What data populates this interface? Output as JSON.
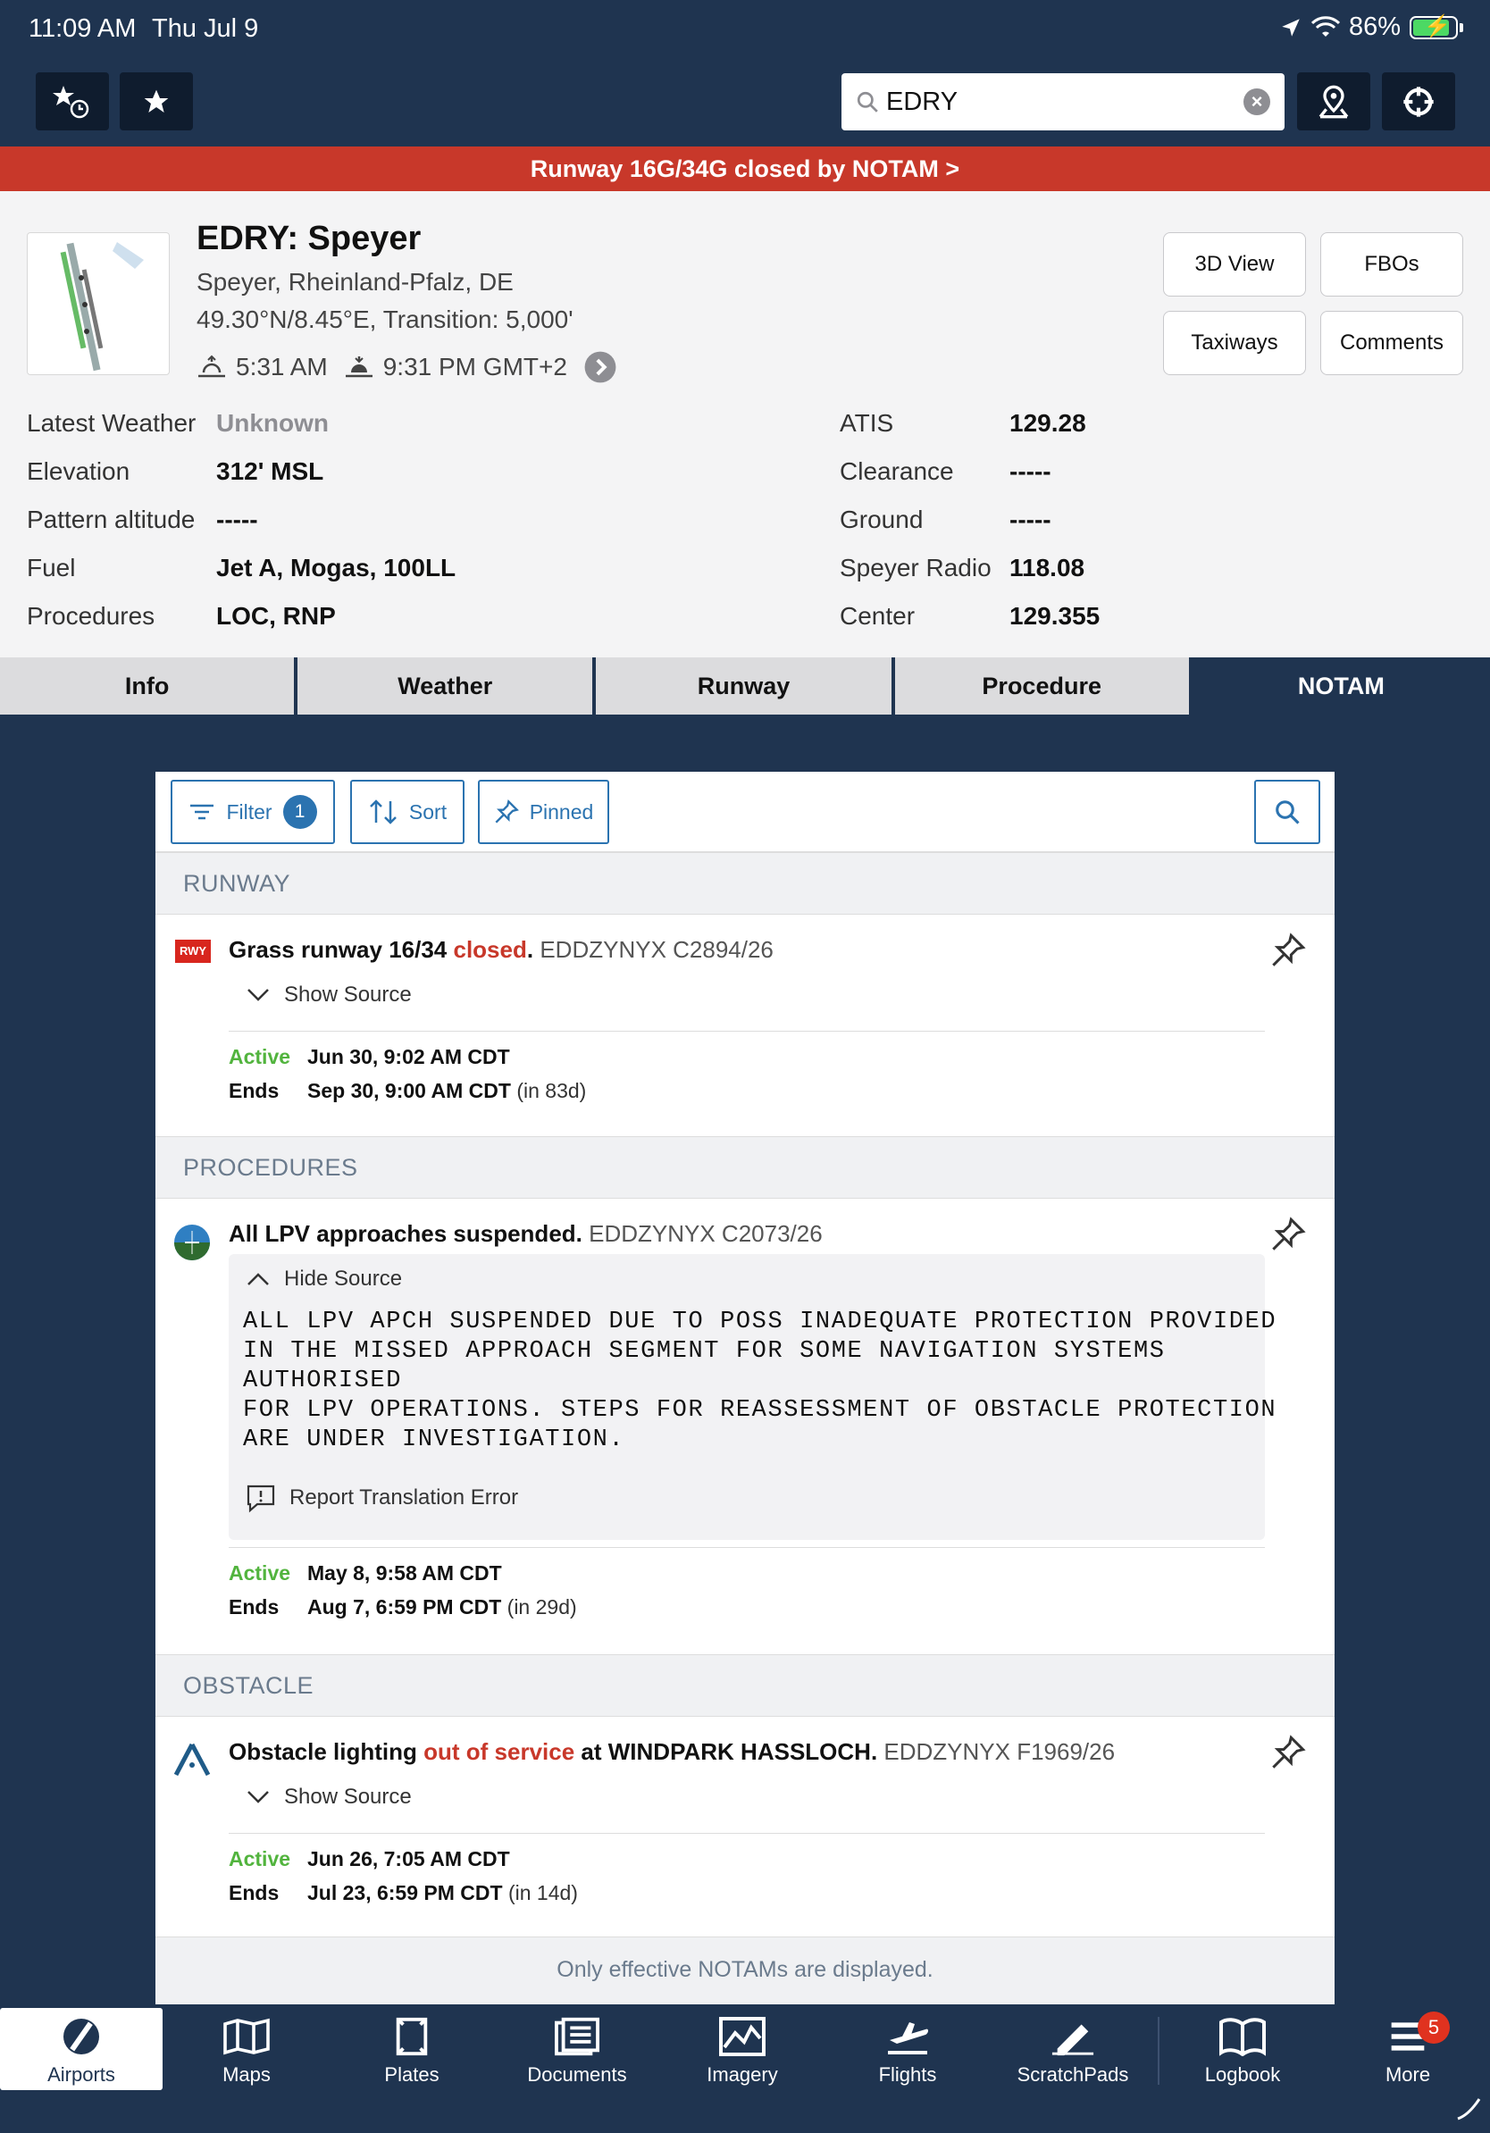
{
  "status_bar": {
    "time": "11:09 AM",
    "date": "Thu Jul 9",
    "battery": "86%"
  },
  "search": {
    "value": "EDRY"
  },
  "alert": {
    "text": "Runway 16G/34G closed by NOTAM >"
  },
  "airport": {
    "title": "EDRY: Speyer",
    "location": "Speyer, Rheinland-Pfalz, DE",
    "coords": "49.30°N/8.45°E, Transition: 5,000'",
    "sunrise": "5:31 AM",
    "sunset": "9:31 PM GMT+2"
  },
  "header_buttons": {
    "view3d": "3D View",
    "fbos": "FBOs",
    "taxiways": "Taxiways",
    "comments": "Comments"
  },
  "info_left": [
    {
      "label": "Latest Weather",
      "value": "Unknown"
    },
    {
      "label": "Elevation",
      "value": "312' MSL"
    },
    {
      "label": "Pattern altitude",
      "value": "-----"
    },
    {
      "label": "Fuel",
      "value": "Jet A, Mogas, 100LL"
    },
    {
      "label": "Procedures",
      "value": "LOC, RNP"
    }
  ],
  "info_right": [
    {
      "label": "ATIS",
      "value": "129.28"
    },
    {
      "label": "Clearance",
      "value": "-----"
    },
    {
      "label": "Ground",
      "value": "-----"
    },
    {
      "label": "Speyer Radio",
      "value": "118.08"
    },
    {
      "label": "Center",
      "value": "129.355"
    }
  ],
  "tabs": [
    "Info",
    "Weather",
    "Runway",
    "Procedure",
    "NOTAM"
  ],
  "active_tab": "NOTAM",
  "notam_toolbar": {
    "filter": "Filter",
    "filter_count": "1",
    "sort": "Sort",
    "pinned": "Pinned"
  },
  "sections": [
    {
      "name": "RUNWAY",
      "notam": {
        "icon_label": "RWY",
        "title_pre": "Grass runway 16/34 ",
        "title_red": "closed",
        "title_post": ".",
        "id": "EDDZYNYX C2894/26",
        "source_toggle": "Show Source",
        "active_label": "Active",
        "active": "Jun 30, 9:02 AM CDT",
        "ends_label": "Ends",
        "ends": "Sep 30, 9:00 AM CDT",
        "ends_rel": "(in 83d)"
      }
    },
    {
      "name": "PROCEDURES",
      "notam": {
        "title_pre": "All LPV approaches suspended.",
        "id": "EDDZYNYX C2073/26",
        "source_toggle": "Hide Source",
        "source_lines": [
          "ALL LPV APCH SUSPENDED DUE TO POSS INADEQUATE PROTECTION PROVIDED",
          "IN THE MISSED APPROACH SEGMENT FOR SOME NAVIGATION SYSTEMS",
          "AUTHORISED",
          "FOR LPV OPERATIONS. STEPS FOR REASSESSMENT OF OBSTACLE PROTECTION",
          "ARE UNDER INVESTIGATION."
        ],
        "report_error": "Report Translation Error",
        "active_label": "Active",
        "active": "May 8, 9:58 AM CDT",
        "ends_label": "Ends",
        "ends": "Aug 7, 6:59 PM CDT",
        "ends_rel": "(in 29d)"
      }
    },
    {
      "name": "OBSTACLE",
      "notam": {
        "title_pre": "Obstacle lighting ",
        "title_red": "out of service",
        "title_post": " at WINDPARK HASSLOCH.",
        "id": "EDDZYNYX F1969/26",
        "source_toggle": "Show Source",
        "active_label": "Active",
        "active": "Jun 26, 7:05 AM CDT",
        "ends_label": "Ends",
        "ends": "Jul 23, 6:59 PM CDT",
        "ends_rel": "(in 14d)"
      }
    }
  ],
  "footer_note": "Only effective NOTAMs are displayed.",
  "bottom_nav": [
    {
      "label": "Airports",
      "icon": "airport-icon",
      "active": true
    },
    {
      "label": "Maps",
      "icon": "map-icon"
    },
    {
      "label": "Plates",
      "icon": "plates-icon"
    },
    {
      "label": "Documents",
      "icon": "documents-icon"
    },
    {
      "label": "Imagery",
      "icon": "imagery-icon"
    },
    {
      "label": "Flights",
      "icon": "flights-icon"
    },
    {
      "label": "ScratchPads",
      "icon": "pencil-icon"
    },
    {
      "label": "Logbook",
      "icon": "logbook-icon"
    },
    {
      "label": "More",
      "icon": "menu-icon",
      "badge": "5"
    }
  ],
  "colors": {
    "navy": "#1f3450",
    "alert_red": "#c8382a",
    "link_blue": "#2b73b0",
    "active_green": "#52b43e"
  }
}
